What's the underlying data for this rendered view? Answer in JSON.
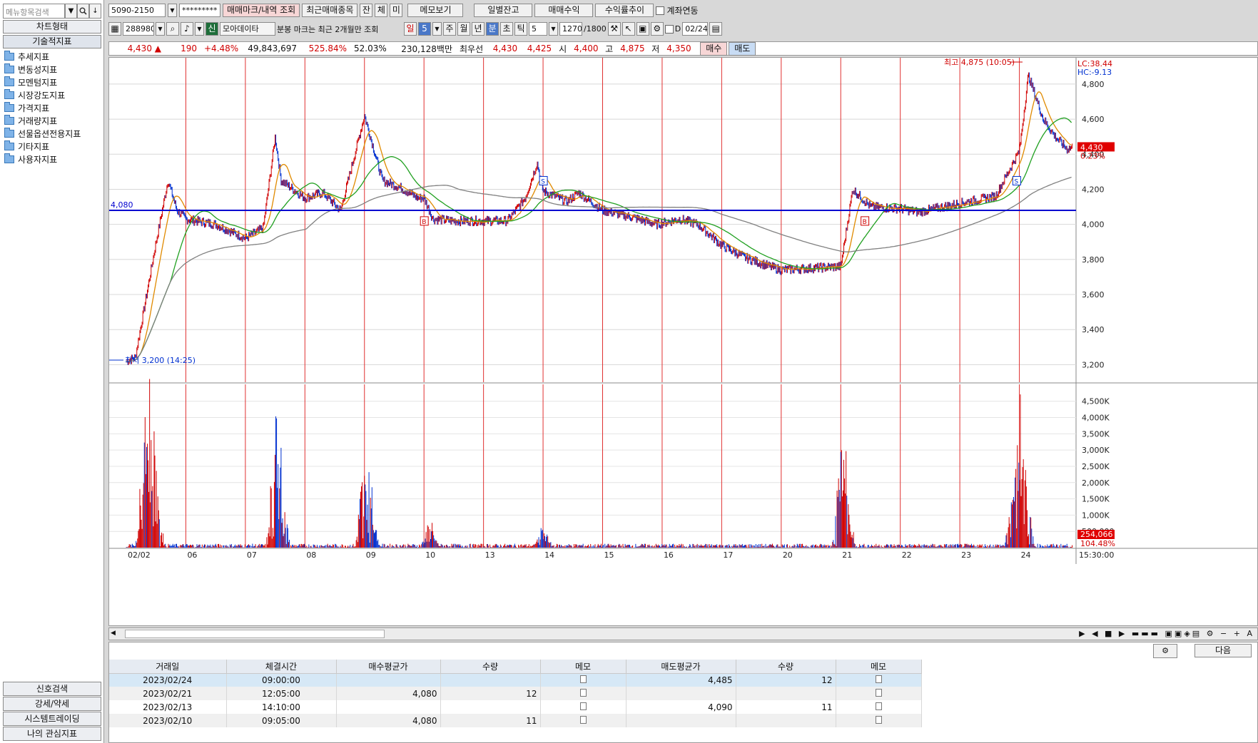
{
  "sidebar": {
    "search_placeholder": "메뉴항목검색",
    "tab_chart_type": "차트형태",
    "tab_technical": "기술적지표",
    "tree": [
      "추세지표",
      "변동성지표",
      "모멘텀지표",
      "시장강도지표",
      "가격지표",
      "거래량지표",
      "선물옵션전용지표",
      "기타지표",
      "사용자지표"
    ],
    "bottom": [
      "신호검색",
      "강세/약세",
      "시스템트레이딩",
      "나의 관심지표"
    ]
  },
  "toolbar1": {
    "account": "5090-2150",
    "password": "*********",
    "btn_trade_mark": "매매마크/내역 조회",
    "btn_recent": "최근매매종목",
    "toggle_jan": "잔",
    "toggle_che": "체",
    "toggle_mi": "미",
    "btn_memo": "메모보기",
    "btn_daily": "일별잔고",
    "btn_profit": "매매수익",
    "btn_yield": "수익률추이",
    "link_label": "계좌연동"
  },
  "toolbar2": {
    "code": "288980",
    "badge_new": "신",
    "stock_name": "모아데이타",
    "notice": "분봉 마크는 최근 2개월만 조회",
    "period_day": "일",
    "period_num": "5",
    "period_week": "주",
    "period_month": "월",
    "period_year": "년",
    "period_min": "분",
    "period_sec": "초",
    "period_tick": "틱",
    "interval": "5",
    "count": "1270",
    "count_max": "/1800",
    "date_flag": "D",
    "date": "02/24"
  },
  "pricebar": {
    "price": "4,430 ▲",
    "change": "190",
    "change_pct": "+4.48%",
    "volume": "49,843,697",
    "vol_ratio": "525.84%",
    "turnover": "52.03%",
    "amount": "230,128백만",
    "best_label": "최우선",
    "best_ask": "4,430",
    "best_bid": "4,425",
    "open_label": "시",
    "open": "4,400",
    "high_label": "고",
    "high": "4,875",
    "low_label": "저",
    "low": "4,350",
    "buy_btn": "매수",
    "sell_btn": "매도"
  },
  "chart_data": {
    "type": "line",
    "title": "",
    "price_axis": {
      "min": 3100,
      "max": 4950,
      "ticks": [
        "4,800",
        "4,600",
        "4,400",
        "4,200",
        "4,000",
        "3,800",
        "3,600",
        "3,400",
        "3,200"
      ]
    },
    "volume_axis": {
      "max": 4800000,
      "ticks": [
        "4,500K",
        "4,000K",
        "3,500K",
        "3,000K",
        "2,500K",
        "2,000K",
        "1,500K",
        "1,000K",
        "500,000"
      ]
    },
    "x_dates": [
      "02/02",
      "06",
      "07",
      "08",
      "09",
      "10",
      "13",
      "14",
      "15",
      "16",
      "17",
      "20",
      "21",
      "22",
      "23",
      "24"
    ],
    "last_time": "15:30:00",
    "support_line": {
      "label": "4,080",
      "value": 4080
    },
    "high_annotation": "최고 4,875 (10:05)",
    "low_annotation": "최저 3,200 (14:25)",
    "lc_label": "LC:38.44",
    "hc_label": "HC:-9.13",
    "current_price_label": "4,430",
    "current_pct_label": "0.23%",
    "volume_value_label": "254,066",
    "volume_pct_label": "104.48%",
    "price_anchors": [
      [
        0,
        3220
      ],
      [
        0.15,
        3240
      ],
      [
        0.5,
        3900
      ],
      [
        0.7,
        4250
      ],
      [
        0.85,
        4080
      ],
      [
        1.0,
        4030
      ],
      [
        1.5,
        4000
      ],
      [
        2.0,
        3920
      ],
      [
        2.3,
        3980
      ],
      [
        2.5,
        4500
      ],
      [
        2.6,
        4250
      ],
      [
        3.0,
        4150
      ],
      [
        3.3,
        4180
      ],
      [
        3.6,
        4080
      ],
      [
        4.0,
        4620
      ],
      [
        4.3,
        4250
      ],
      [
        4.6,
        4210
      ],
      [
        4.9,
        4150
      ],
      [
        5.0,
        4150
      ],
      [
        5.15,
        4030
      ],
      [
        5.5,
        4020
      ],
      [
        6.0,
        4020
      ],
      [
        6.4,
        4020
      ],
      [
        6.7,
        4150
      ],
      [
        6.9,
        4350
      ],
      [
        7.0,
        4190
      ],
      [
        7.4,
        4130
      ],
      [
        7.6,
        4180
      ],
      [
        8.0,
        4080
      ],
      [
        8.5,
        4040
      ],
      [
        8.9,
        4000
      ],
      [
        9.3,
        4030
      ],
      [
        9.6,
        4000
      ],
      [
        10.0,
        3880
      ],
      [
        10.4,
        3810
      ],
      [
        10.8,
        3760
      ],
      [
        11.0,
        3740
      ],
      [
        11.5,
        3750
      ],
      [
        12.0,
        3760
      ],
      [
        12.2,
        4200
      ],
      [
        12.5,
        4100
      ],
      [
        13.0,
        4090
      ],
      [
        13.3,
        4070
      ],
      [
        14.0,
        4120
      ],
      [
        14.6,
        4160
      ],
      [
        15.0,
        4420
      ],
      [
        15.15,
        4850
      ],
      [
        15.4,
        4600
      ],
      [
        15.6,
        4500
      ],
      [
        15.8,
        4430
      ],
      [
        15.9,
        4440
      ]
    ],
    "volume_spikes": [
      [
        0.3,
        3500000
      ],
      [
        0.4,
        4700000
      ],
      [
        0.5,
        2800000
      ],
      [
        2.5,
        3900000
      ],
      [
        2.6,
        2600000
      ],
      [
        4.0,
        3500000
      ],
      [
        4.1,
        1800000
      ],
      [
        5.1,
        900000
      ],
      [
        7.0,
        700000
      ],
      [
        12.0,
        3000000
      ],
      [
        12.1,
        2300000
      ],
      [
        14.9,
        1800000
      ],
      [
        15.0,
        4000000
      ],
      [
        15.1,
        2400000
      ]
    ],
    "signals": [
      {
        "day": 5.0,
        "label": "B"
      },
      {
        "day": 7.0,
        "label": "S"
      },
      {
        "day": 12.4,
        "label": "B"
      },
      {
        "day": 14.95,
        "label": "S"
      }
    ]
  },
  "bottom_panel": {
    "next_btn": "다음",
    "columns": [
      "거래일",
      "체결시간",
      "매수평균가",
      "수량",
      "메모",
      "매도평균가",
      "수량",
      "메모"
    ],
    "rows": [
      [
        "2023/02/24",
        "09:00:00",
        "",
        "",
        "",
        "4,485",
        "12",
        ""
      ],
      [
        "2023/02/21",
        "12:05:00",
        "4,080",
        "12",
        "",
        "",
        "",
        ""
      ],
      [
        "2023/02/13",
        "14:10:00",
        "",
        "",
        "",
        "4,090",
        "11",
        ""
      ],
      [
        "2023/02/10",
        "09:05:00",
        "4,080",
        "11",
        "",
        "",
        "",
        ""
      ]
    ]
  },
  "colors": {
    "up": "#d00000",
    "down": "#0030d0",
    "support": "#0000d0",
    "ma5": "#e08a00",
    "ma20": "#20a020",
    "ma60": "#808080",
    "vline": "#e03030"
  }
}
